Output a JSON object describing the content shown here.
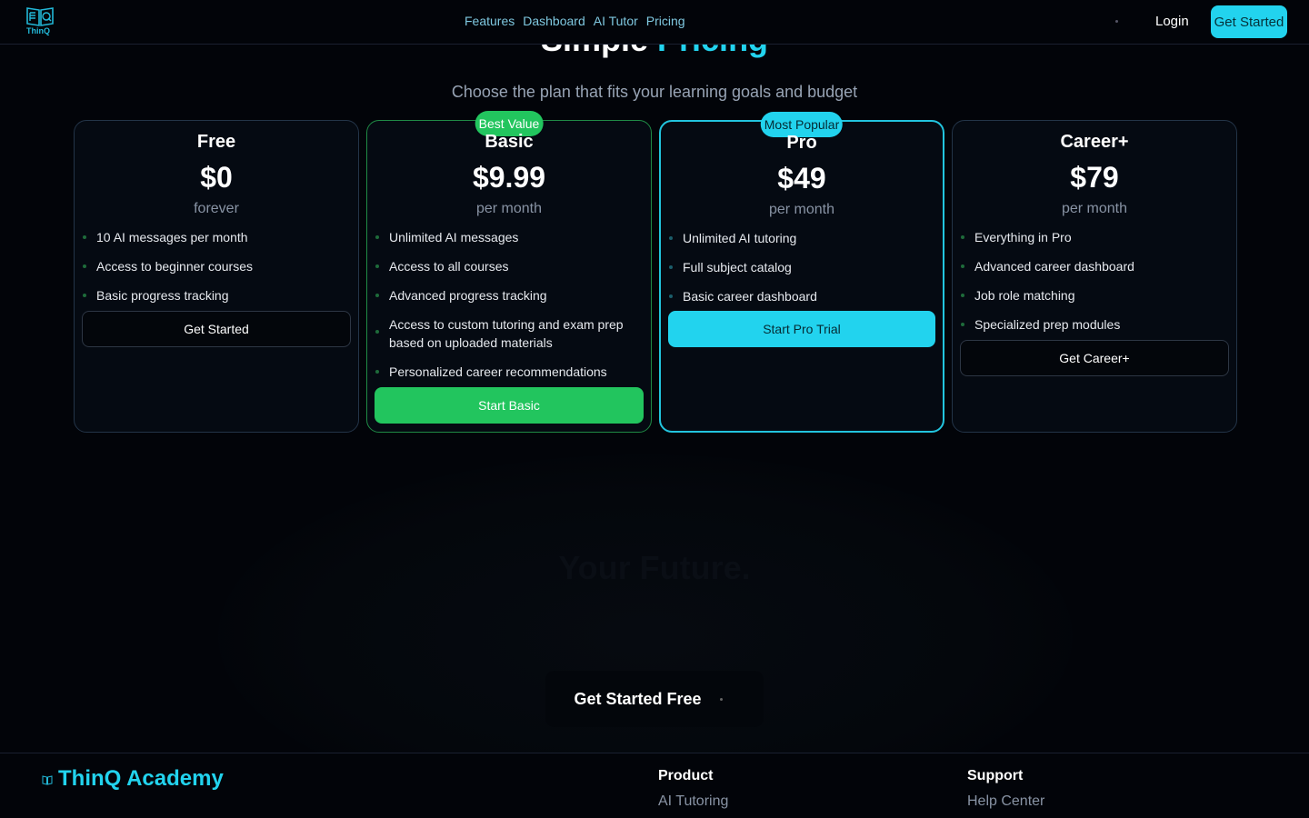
{
  "nav": {
    "logo_text": "ThinQ",
    "links": [
      "Features",
      "Dashboard",
      "AI Tutor",
      "Pricing"
    ],
    "login": "Login",
    "cta": "Get Started"
  },
  "pricing": {
    "title_main": "Simple",
    "title_accent": "Pricing",
    "subtitle": "Choose the plan that fits your learning goals and budget",
    "plans": [
      {
        "name": "Free",
        "price": "$0",
        "period": "forever",
        "badge": "",
        "features": [
          "10 AI messages per month",
          "Access to beginner courses",
          "Basic progress tracking"
        ],
        "button": "Get Started"
      },
      {
        "name": "Basic",
        "price": "$9.99",
        "period": "per month",
        "badge": "Best Value",
        "features": [
          "Unlimited AI messages",
          "Access to all courses",
          "Advanced progress tracking",
          "Access to custom tutoring and exam prep based on uploaded materials",
          "Personalized career recommendations"
        ],
        "button": "Start Basic"
      },
      {
        "name": "Pro",
        "price": "$49",
        "period": "per month",
        "badge": "Most Popular",
        "features": [
          "Unlimited AI tutoring",
          "Full subject catalog",
          "Basic career dashboard"
        ],
        "button": "Start Pro Trial"
      },
      {
        "name": "Career+",
        "price": "$79",
        "period": "per month",
        "badge": "",
        "features": [
          "Everything in Pro",
          "Advanced career dashboard",
          "Job role matching",
          "Specialized prep modules"
        ],
        "button": "Get Career+"
      }
    ]
  },
  "cta": {
    "title": "Your Future.",
    "button": "Get Started Free"
  },
  "footer": {
    "brand": "ThinQ Academy",
    "columns": [
      {
        "heading": "Product",
        "link": "AI Tutoring"
      },
      {
        "heading": "Support",
        "link": "Help Center"
      }
    ]
  },
  "colors": {
    "accent": "#22d3ee",
    "green": "#22c55e",
    "background": "#020409"
  }
}
